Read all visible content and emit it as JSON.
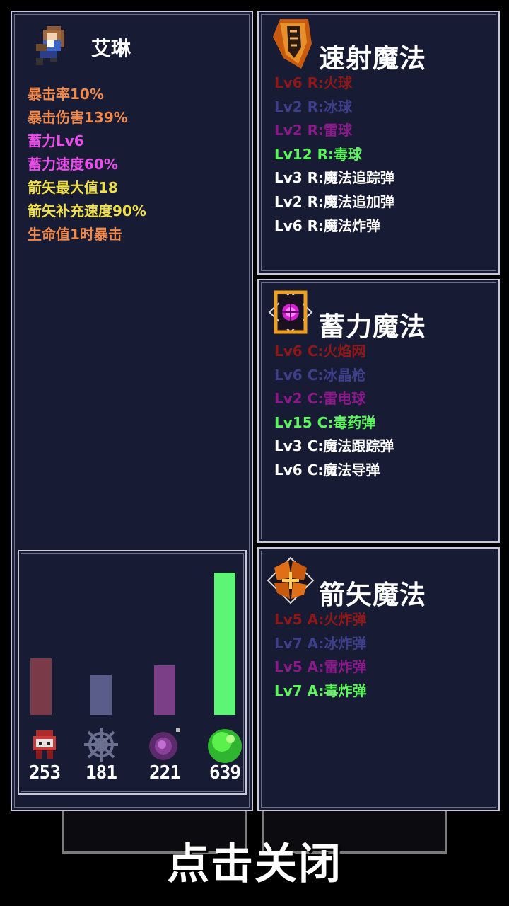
{
  "character": {
    "name": "艾琳",
    "stats": [
      {
        "text": "暴击率10%",
        "color": "#f0894c"
      },
      {
        "text": "暴击伤害139%",
        "color": "#f0894c"
      },
      {
        "text": "蓄力Lv6",
        "color": "#e84ee8"
      },
      {
        "text": "蓄力速度60%",
        "color": "#e84ee8"
      },
      {
        "text": "箭矢最大值18",
        "color": "#f0e04c"
      },
      {
        "text": "箭矢补充速度90%",
        "color": "#f0e04c"
      },
      {
        "text": "生命值1时暴击",
        "color": "#f0894c"
      }
    ]
  },
  "resources": [
    {
      "icon": "fire-skull-icon",
      "value": "253",
      "count": 253,
      "color": "#7a3a48"
    },
    {
      "icon": "ice-web-icon",
      "value": "181",
      "count": 181,
      "color": "#5a5d8a"
    },
    {
      "icon": "thunder-orb-icon",
      "value": "221",
      "count": 221,
      "color": "#7a3f86"
    },
    {
      "icon": "poison-slime-icon",
      "value": "639",
      "count": 639,
      "color": "#5cf575"
    }
  ],
  "magics": {
    "rapid": {
      "title": "速射魔法",
      "icon": "rapid-magic-icon",
      "spells": [
        {
          "text": "Lv6 R:火球",
          "color": "#8e1818"
        },
        {
          "text": "Lv2 R:冰球",
          "color": "#3e3f8a"
        },
        {
          "text": "Lv2 R:雷球",
          "color": "#8a1a8a"
        },
        {
          "text": "Lv12 R:毒球",
          "color": "#5cf55c"
        },
        {
          "text": "Lv3 R:魔法追踪弹",
          "color": "#ffffff"
        },
        {
          "text": "Lv2 R:魔法追加弹",
          "color": "#ffffff"
        },
        {
          "text": "Lv6 R:魔法炸弹",
          "color": "#ffffff"
        }
      ]
    },
    "charge": {
      "title": "蓄力魔法",
      "icon": "charge-magic-icon",
      "spells": [
        {
          "text": "Lv6 C:火焰网",
          "color": "#8e1818"
        },
        {
          "text": "Lv6 C:冰晶枪",
          "color": "#3e3f8a"
        },
        {
          "text": "Lv2 C:雷电球",
          "color": "#8a1a8a"
        },
        {
          "text": "Lv15 C:毒药弹",
          "color": "#5cf55c"
        },
        {
          "text": "Lv3 C:魔法跟踪弹",
          "color": "#ffffff"
        },
        {
          "text": "Lv6 C:魔法导弹",
          "color": "#ffffff"
        }
      ]
    },
    "arrow": {
      "title": "箭矢魔法",
      "icon": "arrow-magic-icon",
      "spells": [
        {
          "text": "Lv5 A:火炸弹",
          "color": "#8e1818"
        },
        {
          "text": "Lv7 A:冰炸弹",
          "color": "#3e3f8a"
        },
        {
          "text": "Lv5 A:雷炸弹",
          "color": "#8a1a8a"
        },
        {
          "text": "Lv7 A:毒炸弹",
          "color": "#5cf55c"
        }
      ]
    }
  },
  "close_label": "点击关闭"
}
